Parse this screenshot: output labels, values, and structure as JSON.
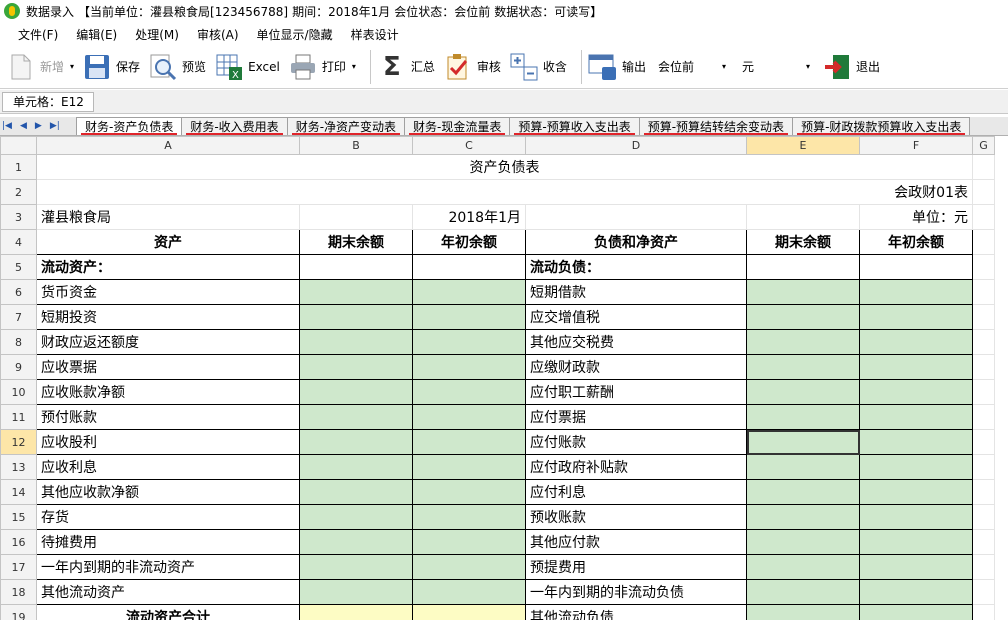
{
  "window": {
    "title": "数据录入",
    "unit_label": "【当前单位：灌县粮食局[123456788]",
    "period": "期间：2018年1月",
    "merge_status": "会位状态：会位前",
    "data_status": "数据状态：可读写】"
  },
  "menu": [
    "文件(F)",
    "编辑(E)",
    "处理(M)",
    "审核(A)",
    "单位显示/隐藏",
    "样表设计"
  ],
  "toolbar": {
    "new": "新增",
    "save": "保存",
    "preview": "预览",
    "excel": "Excel",
    "print": "打印",
    "summary": "汇总",
    "audit": "审核",
    "collect": "收含",
    "output": "输出",
    "merge_select": "会位前",
    "currency_select": "元",
    "exit": "退出"
  },
  "cellbar": {
    "label": "单元格：E12"
  },
  "tabs": [
    "财务-资产负债表",
    "财务-收入费用表",
    "财务-净资产变动表",
    "财务-现金流量表",
    "预算-预算收入支出表",
    "预算-预算结转结余变动表",
    "预算-财政拨款预算收入支出表"
  ],
  "colors": {
    "underline": "#e0242a",
    "green_cell": "#cfe8cc",
    "yellow_cell": "#fdfcc4",
    "selected_header": "#fde6a8"
  },
  "columns": [
    "A",
    "B",
    "C",
    "D",
    "E",
    "F",
    "G"
  ],
  "sheet": {
    "title": "资产负债表",
    "form_code": "会政财01表",
    "org": "灌县粮食局",
    "period": "2018年1月",
    "unit": "单位：元",
    "headers": [
      "资产",
      "期末余额",
      "年初余额",
      "负债和净资产",
      "期末余额",
      "年初余额"
    ],
    "left_section": "流动资产：",
    "right_section": "流动负债：",
    "left_items": [
      "货币资金",
      "短期投资",
      "财政应返还额度",
      "应收票据",
      "应收账款净额",
      "预付账款",
      "应收股利",
      "应收利息",
      "其他应收款净额",
      "存货",
      "待摊费用",
      "一年内到期的非流动资产",
      "其他流动资产",
      "流动资产合计"
    ],
    "right_items": [
      "短期借款",
      "应交增值税",
      "其他应交税费",
      "应缴财政款",
      "应付职工薪酬",
      "应付票据",
      "应付账款",
      "应付政府补贴款",
      "应付利息",
      "预收账款",
      "其他应付款",
      "预提费用",
      "一年内到期的非流动负债",
      "其他流动负债"
    ],
    "row_numbers": [
      "1",
      "2",
      "3",
      "4",
      "5",
      "6",
      "7",
      "8",
      "9",
      "10",
      "11",
      "12",
      "13",
      "14",
      "15",
      "16",
      "17",
      "18",
      "19"
    ]
  }
}
